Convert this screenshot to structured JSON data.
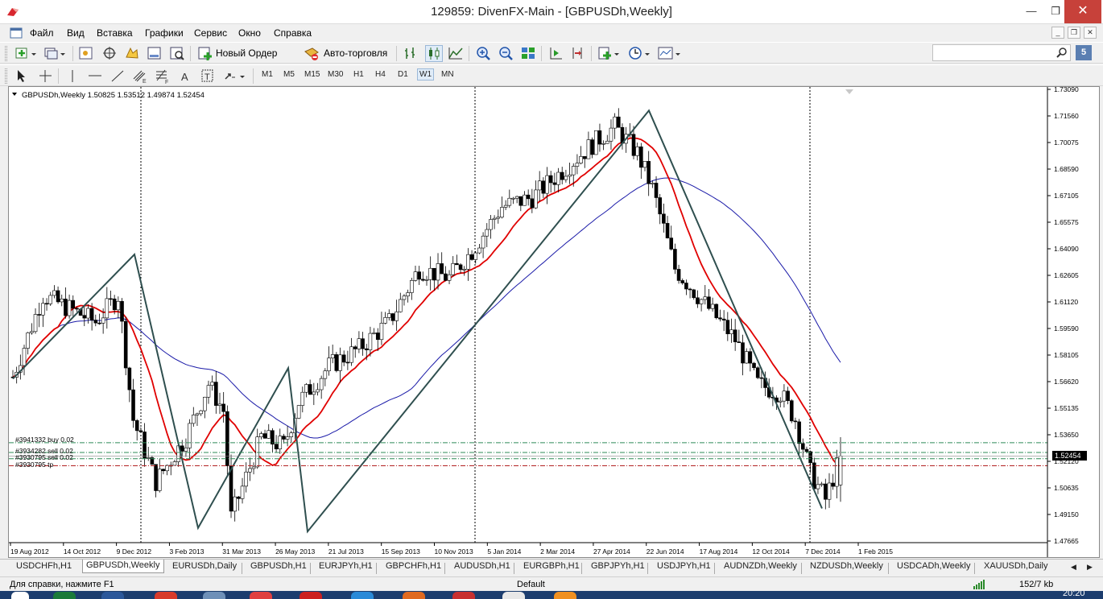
{
  "window": {
    "title": "129859: DivenFX-Main - [GBPUSDh,Weekly]",
    "min": "—",
    "max": "❐",
    "close": "✕"
  },
  "menu": [
    "Файл",
    "Вид",
    "Вставка",
    "Графики",
    "Сервис",
    "Окно",
    "Справка"
  ],
  "toolbar": {
    "new_order_label": "Новый Ордер",
    "autotrading_label": "Авто-торговля",
    "search_placeholder": "",
    "help_badge": "5",
    "timeframes": [
      "M1",
      "M5",
      "M15",
      "M30",
      "H1",
      "H4",
      "D1",
      "W1",
      "MN"
    ],
    "active_timeframe": "W1"
  },
  "chart": {
    "header": "GBPUSDh,Weekly  1.50825 1.53512 1.49874 1.52454",
    "current_price": "1.52454",
    "price_labels": [
      "1.73090",
      "1.71560",
      "1.70075",
      "1.68590",
      "1.67105",
      "1.65575",
      "1.64090",
      "1.62605",
      "1.61120",
      "1.59590",
      "1.58105",
      "1.56620",
      "1.55135",
      "1.53650",
      "1.52120",
      "1.50635",
      "1.49150",
      "1.47665"
    ],
    "date_labels": [
      "19 Aug 2012",
      "14 Oct 2012",
      "9 Dec 2012",
      "3 Feb 2013",
      "31 Mar 2013",
      "26 May 2013",
      "21 Jul 2013",
      "15 Sep 2013",
      "10 Nov 2013",
      "5 Jan 2014",
      "2 Mar 2014",
      "27 Apr 2014",
      "22 Jun 2014",
      "17 Aug 2014",
      "12 Oct 2014",
      "7 Dec 2014",
      "1 Feb 2015"
    ],
    "order_labels": [
      "#3941332 buy 0.02",
      "#3934282 sell 0.02",
      "#3930795 sell 0.02",
      "#3930795 tp"
    ],
    "colors": {
      "up": "#ffffff",
      "down": "#000000",
      "ma_fast": "#e00000",
      "ma_slow": "#1a1aa8",
      "zigzag": "#2f4f4f",
      "buy_line": "#2e8b57",
      "sell_line": "#b22222"
    }
  },
  "chart_data": {
    "type": "candlestick",
    "symbol": "GBPUSDh",
    "timeframe": "Weekly",
    "last_bar": {
      "open": 1.50825,
      "high": 1.53512,
      "low": 1.49874,
      "close": 1.52454
    },
    "ylim": [
      1.47665,
      1.7309
    ],
    "zigzag_points": [
      {
        "date": "Jul 2012",
        "price": 1.568
      },
      {
        "date": "Jan 2013",
        "price": 1.638
      },
      {
        "date": "Mar 2013",
        "price": 1.484
      },
      {
        "date": "Jun 2013",
        "price": 1.574
      },
      {
        "date": "Jul 2013",
        "price": 1.482
      },
      {
        "date": "Jul 2014",
        "price": 1.719
      },
      {
        "date": "Jan 2015",
        "price": 1.495
      }
    ],
    "order_levels": [
      {
        "label": "#3941332 buy 0.02",
        "price": 1.532
      },
      {
        "label": "#3934282 sell 0.02",
        "price": 1.5265
      },
      {
        "label": "#3930795 sell 0.02",
        "price": 1.523
      },
      {
        "label": "#3930795 tp",
        "price": 1.519
      }
    ]
  },
  "tabs": [
    "USDCHFh,H1",
    "GBPUSDh,Weekly",
    "EURUSDh,Daily",
    "GBPUSDh,H1",
    "EURJPYh,H1",
    "GBPCHFh,H1",
    "AUDUSDh,H1",
    "EURGBPh,H1",
    "GBPJPYh,H1",
    "USDJPYh,H1",
    "AUDNZDh,Weekly",
    "NZDUSDh,Weekly",
    "USDCADh,Weekly",
    "XAUUSDh,Daily"
  ],
  "active_tab": "GBPUSDh,Weekly",
  "status": {
    "help": "Для справки, нажмите F1",
    "profile": "Default",
    "traffic": "152/7 kb"
  },
  "taskbar": {
    "clock": "20:20"
  }
}
